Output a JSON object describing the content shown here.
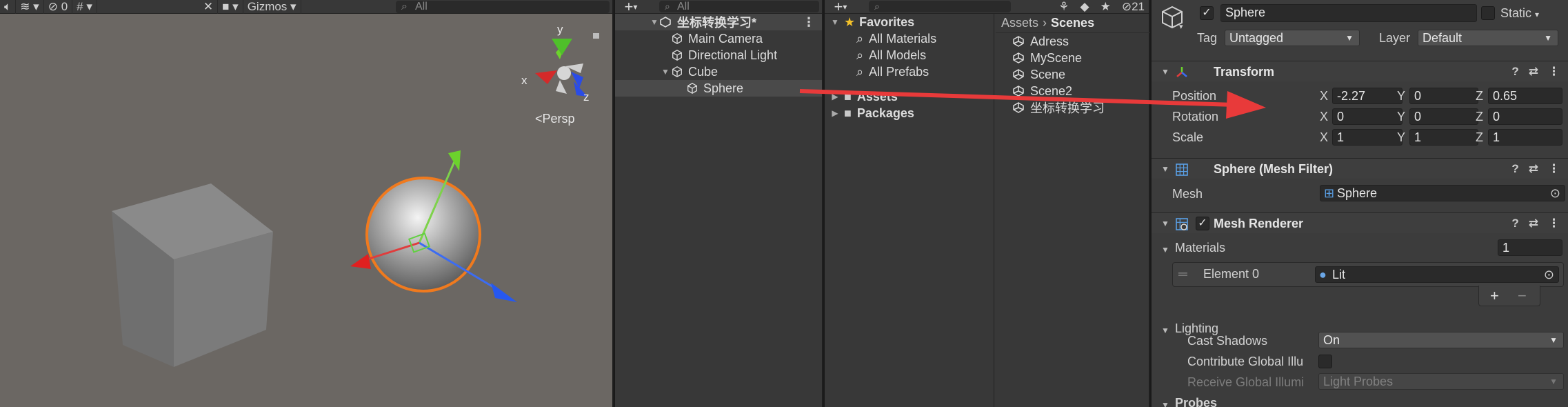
{
  "scene_view": {
    "toolbar": {
      "audio_icon": "speaker-icon",
      "effects_icon": "layers-icon",
      "hidden_count": "0",
      "gizmos_label": "Gizmos",
      "search_placeholder": "All"
    },
    "gizmo": {
      "x_label": "x",
      "y_label": "y",
      "z_label": "z"
    },
    "projection_label": "Persp"
  },
  "hierarchy": {
    "search_placeholder": "All",
    "scene_name": "坐标转换学习*",
    "items": [
      {
        "label": "Main Camera",
        "depth": 1,
        "expandable": false
      },
      {
        "label": "Directional Light",
        "depth": 1,
        "expandable": false
      },
      {
        "label": "Cube",
        "depth": 1,
        "expandable": true
      },
      {
        "label": "Sphere",
        "depth": 2,
        "expandable": false,
        "selected": true
      }
    ]
  },
  "project": {
    "hidden_count": "21",
    "favorites": {
      "label": "Favorites",
      "items": [
        "All Materials",
        "All Models",
        "All Prefabs"
      ]
    },
    "roots": [
      "Assets",
      "Packages"
    ],
    "breadcrumb": {
      "root": "Assets",
      "current": "Scenes"
    },
    "scenes": [
      "Adress",
      "MyScene",
      "Scene",
      "Scene2",
      "坐标转换学习"
    ]
  },
  "inspector": {
    "object_name": "Sphere",
    "active": true,
    "static_label": "Static",
    "tag_label": "Tag",
    "tag_value": "Untagged",
    "layer_label": "Layer",
    "layer_value": "Default",
    "transform": {
      "title": "Transform",
      "position_label": "Position",
      "rotation_label": "Rotation",
      "scale_label": "Scale",
      "axis_x": "X",
      "axis_y": "Y",
      "axis_z": "Z",
      "position": {
        "x": "-2.27",
        "y": "0",
        "z": "0.65"
      },
      "rotation": {
        "x": "0",
        "y": "0",
        "z": "0"
      },
      "scale": {
        "x": "1",
        "y": "1",
        "z": "1"
      }
    },
    "mesh_filter": {
      "title": "Sphere (Mesh Filter)",
      "mesh_label": "Mesh",
      "mesh_value": "Sphere"
    },
    "mesh_renderer": {
      "title": "Mesh Renderer",
      "enabled": true,
      "materials_label": "Materials",
      "materials_count": "1",
      "element_label": "Element 0",
      "element_value": "Lit",
      "add_label": "+",
      "remove_label": "−",
      "lighting_label": "Lighting",
      "cast_shadows_label": "Cast Shadows",
      "cast_shadows_value": "On",
      "contribute_gi_label": "Contribute Global Illu",
      "receive_gi_label": "Receive Global Illumi",
      "receive_gi_value": "Light Probes",
      "probes_label": "Probes"
    }
  },
  "colors": {
    "scene_bg": "#6b6763",
    "selection_outline": "#f07a1e",
    "annotation_arrow": "#e83a3a",
    "panel_bg": "#383838",
    "inspector_bg": "#3c3c3c"
  }
}
